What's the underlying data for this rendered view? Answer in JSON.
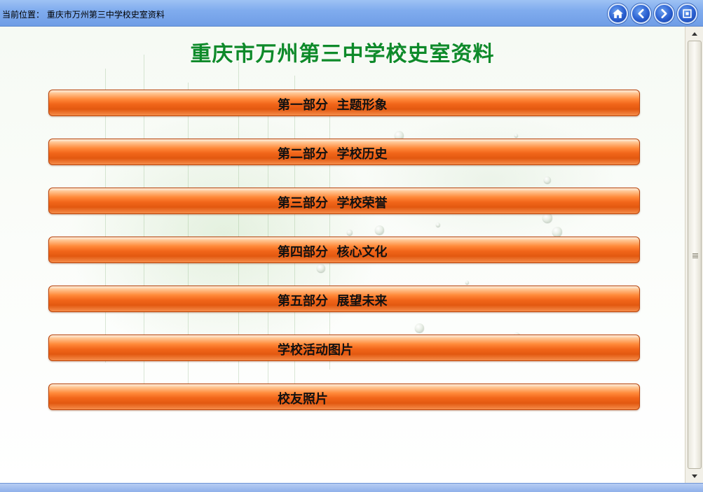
{
  "header": {
    "location_text": "当前位置：  重庆市万州第三中学校史室资料",
    "nav_buttons": [
      {
        "name": "home-icon"
      },
      {
        "name": "back-icon"
      },
      {
        "name": "forward-icon"
      },
      {
        "name": "fullscreen-icon"
      }
    ]
  },
  "main": {
    "title": "重庆市万州第三中学校史室资料",
    "menu": [
      {
        "label": "第一部分  主题形象"
      },
      {
        "label": "第二部分  学校历史"
      },
      {
        "label": "第三部分  学校荣誉"
      },
      {
        "label": "第四部分  核心文化"
      },
      {
        "label": "第五部分  展望未来"
      },
      {
        "label": "学校活动图片"
      },
      {
        "label": "校友照片"
      }
    ]
  },
  "colors": {
    "title": "#0e8a2a",
    "menu_bar": "#f2661a",
    "topbar": "#80acee"
  }
}
